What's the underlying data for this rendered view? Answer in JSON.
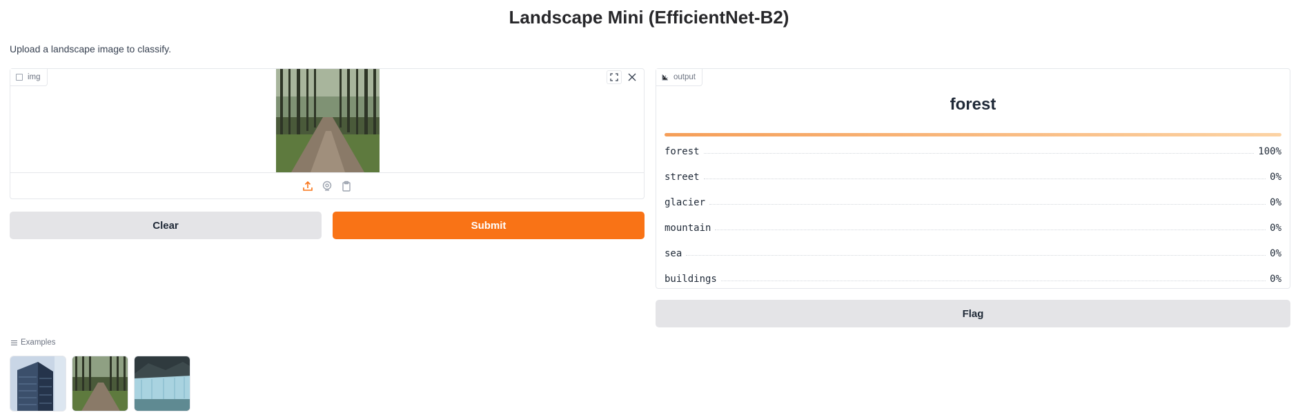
{
  "title": "Landscape Mini (EfficientNet-B2)",
  "description": "Upload a landscape image to classify.",
  "input": {
    "label": "img",
    "label_icon": "image-icon",
    "actions": [
      "fullscreen-icon",
      "close-icon"
    ],
    "sources": [
      "upload-icon",
      "webcam-icon",
      "clipboard-icon"
    ],
    "accent_color": "#f97316"
  },
  "buttons": {
    "clear": "Clear",
    "submit": "Submit",
    "flag": "Flag"
  },
  "output": {
    "label": "output",
    "label_icon": "bar-chart-icon",
    "predicted": "forest",
    "confidences": [
      {
        "label": "forest",
        "value": "100%"
      },
      {
        "label": "street",
        "value": "0%"
      },
      {
        "label": "glacier",
        "value": "0%"
      },
      {
        "label": "mountain",
        "value": "0%"
      },
      {
        "label": "sea",
        "value": "0%"
      },
      {
        "label": "buildings",
        "value": "0%"
      }
    ]
  },
  "examples": {
    "label": "Examples",
    "items": [
      "buildings-thumbnail",
      "forest-thumbnail",
      "glacier-thumbnail"
    ]
  }
}
